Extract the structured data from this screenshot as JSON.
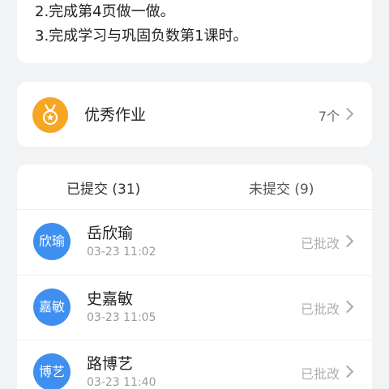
{
  "instructions": {
    "line2": "2.完成第4页做一做。",
    "line3": "3.完成学习与巩固负数第1课时。"
  },
  "excellent": {
    "title": "优秀作业",
    "count": "7个",
    "icon": "medal-icon",
    "icon_color": "#f5a623"
  },
  "tabs": {
    "submitted": "已提交 (31)",
    "not_submitted": "未提交 (9)"
  },
  "students": [
    {
      "avatar_text": "欣瑜",
      "name": "岳欣瑜",
      "time": "03-23 11:02",
      "status": "已批改"
    },
    {
      "avatar_text": "嘉敏",
      "name": "史嘉敏",
      "time": "03-23 11:05",
      "status": "已批改"
    },
    {
      "avatar_text": "博艺",
      "name": "路博艺",
      "time": "03-23 11:40",
      "status": "已批改"
    }
  ],
  "colors": {
    "background": "#f2f3f5",
    "avatar": "#3e8ff0",
    "medal": "#f5a623"
  }
}
